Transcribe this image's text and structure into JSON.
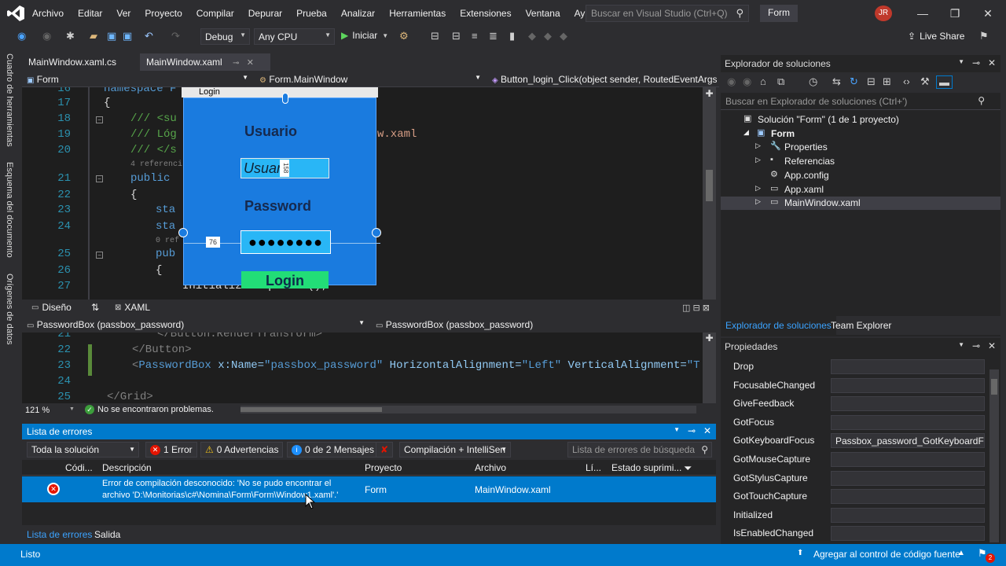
{
  "menubar": {
    "menus": [
      "Archivo",
      "Editar",
      "Ver",
      "Proyecto",
      "Compilar",
      "Depurar",
      "Prueba",
      "Analizar",
      "Herramientas",
      "Extensiones",
      "Ventana",
      "Ayuda"
    ],
    "search_placeholder": "Buscar en Visual Studio (Ctrl+Q)",
    "solution_name": "Form",
    "user_initials": "JR"
  },
  "toolbar": {
    "config": "Debug",
    "platform": "Any CPU",
    "start_label": "Iniciar",
    "live_share": "Live Share"
  },
  "left_strip": [
    "Cuadro de herramientas",
    "Esquema del documento",
    "Orígenes de datos"
  ],
  "doc_tabs": [
    {
      "label": "MainWindow.xaml.cs",
      "active": false
    },
    {
      "label": "MainWindow.xaml",
      "active": true
    }
  ],
  "nav": {
    "project": "Form",
    "class": "Form.MainWindow",
    "member": "Button_login_Click(object sender, RoutedEventArgs"
  },
  "editor": {
    "lines": [
      {
        "n": "16",
        "code": "namespace F"
      },
      {
        "n": "17",
        "code": "{"
      },
      {
        "n": "18",
        "code": "/// <su"
      },
      {
        "n": "19",
        "code": "/// Lóg"
      },
      {
        "n": "20",
        "code": "/// </s"
      },
      {
        "n": "21",
        "code": "public"
      },
      {
        "n": "22",
        "code": "{"
      },
      {
        "n": "23",
        "code": "sta"
      },
      {
        "n": "24",
        "code": "sta"
      },
      {
        "n": "25",
        "code": "pub"
      },
      {
        "n": "26",
        "code": "{"
      },
      {
        "n": "27",
        "code": "InitializeComponent();"
      }
    ],
    "ref_hint_1": "4 referenci",
    "ref_hint_2": "0 ref",
    "right_text": "w.xaml"
  },
  "designer": {
    "window_title": "Login",
    "user_label": "Usuario",
    "user_text": "Usuar",
    "pass_label": "Password",
    "pass_value": "●●●●●●●●",
    "login_button": "Login",
    "dim_left": "76",
    "dim_box": "158"
  },
  "split": {
    "design_tab": "Diseño",
    "swap_icon": "⇅",
    "xaml_tab": "XAML"
  },
  "xaml_nav": {
    "left": "PasswordBox (passbox_password)",
    "right": "PasswordBox (passbox_password)"
  },
  "xaml": {
    "lines": [
      {
        "n": "21",
        "parts": [
          {
            "t": "</Button.RenderTransform>",
            "c": "xg"
          }
        ]
      },
      {
        "n": "22",
        "parts": [
          {
            "t": "</Button>",
            "c": "xg"
          }
        ]
      },
      {
        "n": "23",
        "parts": [
          {
            "t": "<",
            "c": "xg"
          },
          {
            "t": "PasswordBox",
            "c": "xt"
          },
          {
            "t": " x:Name=",
            "c": "xa"
          },
          {
            "t": "\"passbox_password\"",
            "c": "xs"
          },
          {
            "t": " HorizontalAlignment=",
            "c": "xa"
          },
          {
            "t": "\"Left\"",
            "c": "xs"
          },
          {
            "t": " VerticalAlignment=",
            "c": "xa"
          },
          {
            "t": "\"T",
            "c": "xs"
          }
        ]
      },
      {
        "n": "24",
        "parts": []
      },
      {
        "n": "25",
        "parts": [
          {
            "t": "</Grid>",
            "c": "xg"
          }
        ]
      }
    ]
  },
  "minibar": {
    "zoom": "121 %",
    "status": "No se encontraron problemas."
  },
  "errors": {
    "title": "Lista de errores",
    "scope": "Toda la solución",
    "errors_btn": "1 Error",
    "warnings_btn": "0 Advertencias",
    "messages_btn": "0 de 2 Mensajes",
    "build_filter": "Compilación + IntelliSen",
    "search_placeholder": "Lista de errores de búsqueda",
    "columns": [
      "Códi...",
      "Descripción",
      "Proyecto",
      "Archivo",
      "Lí...",
      "Estado suprimi..."
    ],
    "row": {
      "description_1": "Error de compilación desconocido: 'No se pudo encontrar el",
      "description_2": "archivo 'D:\\Monitorias\\c#\\Nomina\\Form\\Form\\Window1.xaml'.'",
      "project": "Form",
      "file": "MainWindow.xaml"
    },
    "bottom_tabs": [
      "Lista de errores",
      "Salida"
    ]
  },
  "solution_explorer": {
    "title": "Explorador de soluciones",
    "search_placeholder": "Buscar en Explorador de soluciones (Ctrl+')",
    "tree": [
      {
        "label": "Solución \"Form\" (1 de 1 proyecto)",
        "level": 0,
        "icon": "solution-icon"
      },
      {
        "label": "Form",
        "level": 1,
        "icon": "csharp-project-icon",
        "bold": true
      },
      {
        "label": "Properties",
        "level": 2,
        "icon": "wrench-icon"
      },
      {
        "label": "Referencias",
        "level": 2,
        "icon": "references-icon"
      },
      {
        "label": "App.config",
        "level": 2,
        "icon": "config-file-icon"
      },
      {
        "label": "App.xaml",
        "level": 2,
        "icon": "xaml-file-icon"
      },
      {
        "label": "MainWindow.xaml",
        "level": 2,
        "icon": "xaml-file-icon",
        "selected": true
      }
    ],
    "tabs": [
      "Explorador de soluciones",
      "Team Explorer"
    ]
  },
  "properties": {
    "title": "Propiedades",
    "rows": [
      {
        "name": "Drop",
        "value": ""
      },
      {
        "name": "FocusableChanged",
        "value": ""
      },
      {
        "name": "GiveFeedback",
        "value": ""
      },
      {
        "name": "GotFocus",
        "value": ""
      },
      {
        "name": "GotKeyboardFocus",
        "value": "Passbox_password_GotKeyboardFocus"
      },
      {
        "name": "GotMouseCapture",
        "value": ""
      },
      {
        "name": "GotStylusCapture",
        "value": ""
      },
      {
        "name": "GotTouchCapture",
        "value": ""
      },
      {
        "name": "Initialized",
        "value": ""
      },
      {
        "name": "IsEnabledChanged",
        "value": ""
      }
    ]
  },
  "statusbar": {
    "left": "Listo",
    "right": "Agregar al control de código fuente",
    "notifications": "2"
  },
  "colors": {
    "accent": "#007acc",
    "error": "#e51400",
    "designer_bg": "#1a7bdf",
    "login_btn": "#22dd77"
  }
}
